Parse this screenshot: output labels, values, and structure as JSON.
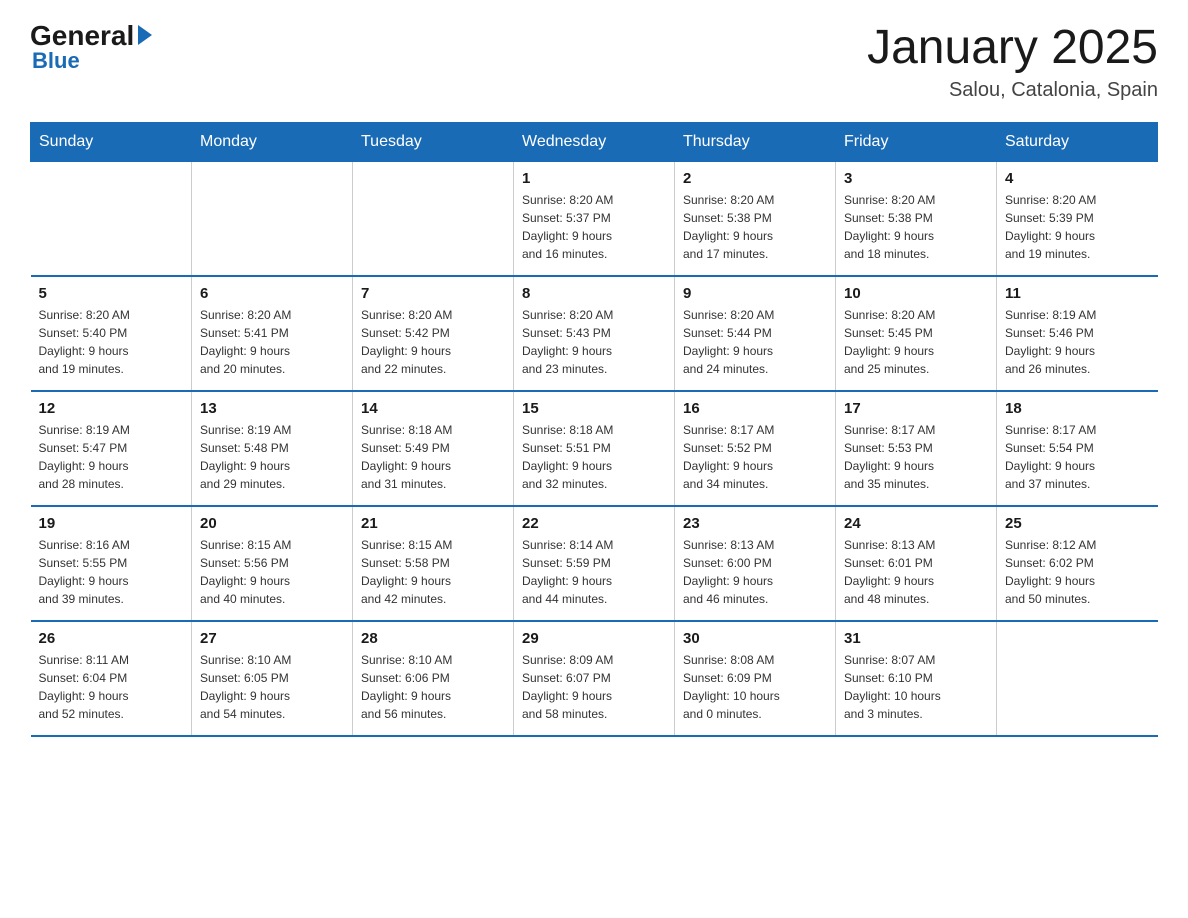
{
  "logo": {
    "general": "General",
    "blue": "Blue"
  },
  "title": {
    "month_year": "January 2025",
    "location": "Salou, Catalonia, Spain"
  },
  "days_of_week": [
    "Sunday",
    "Monday",
    "Tuesday",
    "Wednesday",
    "Thursday",
    "Friday",
    "Saturday"
  ],
  "weeks": [
    [
      {
        "day": "",
        "info": ""
      },
      {
        "day": "",
        "info": ""
      },
      {
        "day": "",
        "info": ""
      },
      {
        "day": "1",
        "info": "Sunrise: 8:20 AM\nSunset: 5:37 PM\nDaylight: 9 hours\nand 16 minutes."
      },
      {
        "day": "2",
        "info": "Sunrise: 8:20 AM\nSunset: 5:38 PM\nDaylight: 9 hours\nand 17 minutes."
      },
      {
        "day": "3",
        "info": "Sunrise: 8:20 AM\nSunset: 5:38 PM\nDaylight: 9 hours\nand 18 minutes."
      },
      {
        "day": "4",
        "info": "Sunrise: 8:20 AM\nSunset: 5:39 PM\nDaylight: 9 hours\nand 19 minutes."
      }
    ],
    [
      {
        "day": "5",
        "info": "Sunrise: 8:20 AM\nSunset: 5:40 PM\nDaylight: 9 hours\nand 19 minutes."
      },
      {
        "day": "6",
        "info": "Sunrise: 8:20 AM\nSunset: 5:41 PM\nDaylight: 9 hours\nand 20 minutes."
      },
      {
        "day": "7",
        "info": "Sunrise: 8:20 AM\nSunset: 5:42 PM\nDaylight: 9 hours\nand 22 minutes."
      },
      {
        "day": "8",
        "info": "Sunrise: 8:20 AM\nSunset: 5:43 PM\nDaylight: 9 hours\nand 23 minutes."
      },
      {
        "day": "9",
        "info": "Sunrise: 8:20 AM\nSunset: 5:44 PM\nDaylight: 9 hours\nand 24 minutes."
      },
      {
        "day": "10",
        "info": "Sunrise: 8:20 AM\nSunset: 5:45 PM\nDaylight: 9 hours\nand 25 minutes."
      },
      {
        "day": "11",
        "info": "Sunrise: 8:19 AM\nSunset: 5:46 PM\nDaylight: 9 hours\nand 26 minutes."
      }
    ],
    [
      {
        "day": "12",
        "info": "Sunrise: 8:19 AM\nSunset: 5:47 PM\nDaylight: 9 hours\nand 28 minutes."
      },
      {
        "day": "13",
        "info": "Sunrise: 8:19 AM\nSunset: 5:48 PM\nDaylight: 9 hours\nand 29 minutes."
      },
      {
        "day": "14",
        "info": "Sunrise: 8:18 AM\nSunset: 5:49 PM\nDaylight: 9 hours\nand 31 minutes."
      },
      {
        "day": "15",
        "info": "Sunrise: 8:18 AM\nSunset: 5:51 PM\nDaylight: 9 hours\nand 32 minutes."
      },
      {
        "day": "16",
        "info": "Sunrise: 8:17 AM\nSunset: 5:52 PM\nDaylight: 9 hours\nand 34 minutes."
      },
      {
        "day": "17",
        "info": "Sunrise: 8:17 AM\nSunset: 5:53 PM\nDaylight: 9 hours\nand 35 minutes."
      },
      {
        "day": "18",
        "info": "Sunrise: 8:17 AM\nSunset: 5:54 PM\nDaylight: 9 hours\nand 37 minutes."
      }
    ],
    [
      {
        "day": "19",
        "info": "Sunrise: 8:16 AM\nSunset: 5:55 PM\nDaylight: 9 hours\nand 39 minutes."
      },
      {
        "day": "20",
        "info": "Sunrise: 8:15 AM\nSunset: 5:56 PM\nDaylight: 9 hours\nand 40 minutes."
      },
      {
        "day": "21",
        "info": "Sunrise: 8:15 AM\nSunset: 5:58 PM\nDaylight: 9 hours\nand 42 minutes."
      },
      {
        "day": "22",
        "info": "Sunrise: 8:14 AM\nSunset: 5:59 PM\nDaylight: 9 hours\nand 44 minutes."
      },
      {
        "day": "23",
        "info": "Sunrise: 8:13 AM\nSunset: 6:00 PM\nDaylight: 9 hours\nand 46 minutes."
      },
      {
        "day": "24",
        "info": "Sunrise: 8:13 AM\nSunset: 6:01 PM\nDaylight: 9 hours\nand 48 minutes."
      },
      {
        "day": "25",
        "info": "Sunrise: 8:12 AM\nSunset: 6:02 PM\nDaylight: 9 hours\nand 50 minutes."
      }
    ],
    [
      {
        "day": "26",
        "info": "Sunrise: 8:11 AM\nSunset: 6:04 PM\nDaylight: 9 hours\nand 52 minutes."
      },
      {
        "day": "27",
        "info": "Sunrise: 8:10 AM\nSunset: 6:05 PM\nDaylight: 9 hours\nand 54 minutes."
      },
      {
        "day": "28",
        "info": "Sunrise: 8:10 AM\nSunset: 6:06 PM\nDaylight: 9 hours\nand 56 minutes."
      },
      {
        "day": "29",
        "info": "Sunrise: 8:09 AM\nSunset: 6:07 PM\nDaylight: 9 hours\nand 58 minutes."
      },
      {
        "day": "30",
        "info": "Sunrise: 8:08 AM\nSunset: 6:09 PM\nDaylight: 10 hours\nand 0 minutes."
      },
      {
        "day": "31",
        "info": "Sunrise: 8:07 AM\nSunset: 6:10 PM\nDaylight: 10 hours\nand 3 minutes."
      },
      {
        "day": "",
        "info": ""
      }
    ]
  ]
}
